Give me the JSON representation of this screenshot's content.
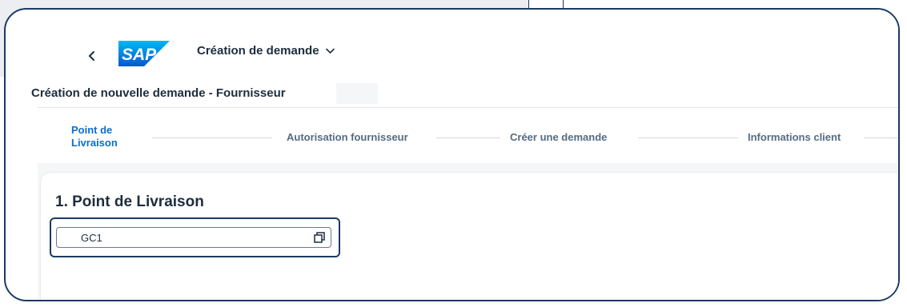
{
  "shell": {
    "back_icon": "chevron-left-icon",
    "logo_text": "SAP",
    "app_title": "Création de demande",
    "title_dropdown_icon": "chevron-down-icon"
  },
  "page": {
    "title": "Création de nouvelle demande - Fournisseur"
  },
  "wizard": {
    "steps": [
      {
        "label": "Point de Livraison",
        "line1": "Point de",
        "line2": "Livraison",
        "active": true
      },
      {
        "label": "Autorisation fournisseur",
        "active": false
      },
      {
        "label": "Créer une demande",
        "active": false
      },
      {
        "label": "Informations client",
        "active": false
      }
    ]
  },
  "section": {
    "title": "1. Point de Livraison",
    "delivery_point": {
      "value": "GC1",
      "value_help_icon": "value-help-icon"
    }
  },
  "colors": {
    "frame": "#1b3a66",
    "sap_blue": "#0a6ed1",
    "step_inactive": "#556b82",
    "text": "#1d2d3e"
  }
}
